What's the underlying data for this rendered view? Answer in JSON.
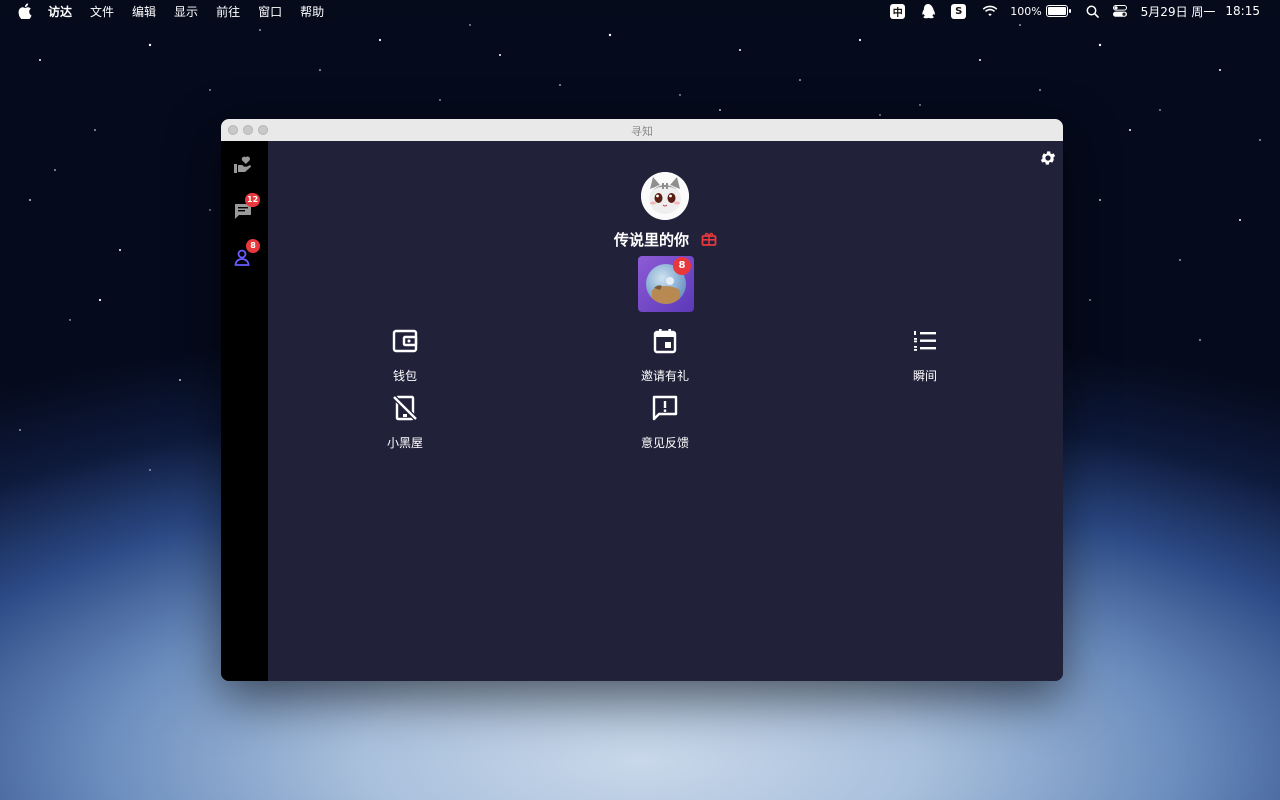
{
  "menubar": {
    "app_name": "访达",
    "items": [
      "文件",
      "编辑",
      "显示",
      "前往",
      "窗口",
      "帮助"
    ],
    "tray": {
      "input_method": "中",
      "sogou": "S",
      "battery_percent": "100%",
      "battery_level": 1.0,
      "date": "5月29日 周一",
      "time": "18:15"
    }
  },
  "window": {
    "title": "寻知"
  },
  "sidebar": {
    "items": [
      {
        "name": "discover",
        "badge": ""
      },
      {
        "name": "messages",
        "badge": "12"
      },
      {
        "name": "profile",
        "badge": "8"
      }
    ]
  },
  "profile": {
    "username": "传说里的你",
    "room_badge": "8"
  },
  "features": [
    {
      "label": "钱包",
      "icon": "wallet-icon"
    },
    {
      "label": "邀请有礼",
      "icon": "calendar-icon"
    },
    {
      "label": "瞬间",
      "icon": "list-icon"
    },
    {
      "label": "小黑屋",
      "icon": "no-phone-icon"
    },
    {
      "label": "意见反馈",
      "icon": "feedback-icon"
    }
  ],
  "colors": {
    "main_bg": "#22213a",
    "sidebar_bg": "#000000",
    "badge": "#e8383d",
    "accent_purple": "#6a5cff",
    "gift_red": "#e8383d"
  }
}
